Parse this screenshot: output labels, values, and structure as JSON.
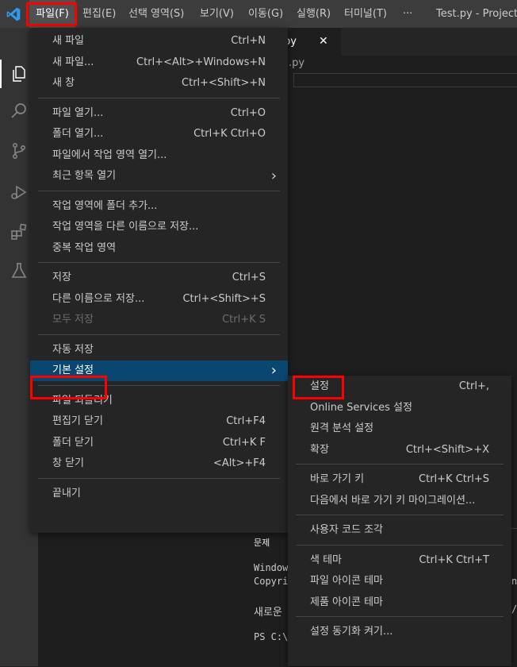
{
  "menubar": {
    "items": [
      "파일(F)",
      "편집(E)",
      "선택 영역(S)",
      "보기(V)",
      "이동(G)",
      "실행(R)",
      "터미널(T)",
      "···"
    ],
    "title": "Test.py - ProjectLic"
  },
  "editor": {
    "tab_label": "py",
    "tab_close": "✕",
    "breadcrumb": ".py"
  },
  "panel": {
    "tab_label": "문제",
    "lines": [
      "Window",
      "Copyri",
      "새로운",
      "PS C:\\"
    ],
    "right_fragments": [
      "nt",
      "/a"
    ]
  },
  "file_menu": {
    "groups": [
      [
        {
          "label": "새 파일",
          "key": "Ctrl+N"
        },
        {
          "label": "새 파일...",
          "key": "Ctrl+<Alt>+Windows+N"
        },
        {
          "label": "새 창",
          "key": "Ctrl+<Shift>+N"
        }
      ],
      [
        {
          "label": "파일 열기...",
          "key": "Ctrl+O"
        },
        {
          "label": "폴더 열기...",
          "key": "Ctrl+K Ctrl+O"
        },
        {
          "label": "파일에서 작업 영역 열기...",
          "key": ""
        },
        {
          "label": "최근 항목 열기",
          "key": "",
          "submenu": true
        }
      ],
      [
        {
          "label": "작업 영역에 폴더 추가...",
          "key": ""
        },
        {
          "label": "작업 영역을 다른 이름으로 저장...",
          "key": ""
        },
        {
          "label": "중복 작업 영역",
          "key": ""
        }
      ],
      [
        {
          "label": "저장",
          "key": "Ctrl+S"
        },
        {
          "label": "다른 이름으로 저장...",
          "key": "Ctrl+<Shift>+S"
        },
        {
          "label": "모두 저장",
          "key": "Ctrl+K S",
          "disabled": true
        }
      ],
      [
        {
          "label": "자동 저장",
          "key": ""
        },
        {
          "label": "기본 설정",
          "key": "",
          "submenu": true,
          "selected": true
        }
      ],
      [
        {
          "label": "파일 되돌리기",
          "key": ""
        },
        {
          "label": "편집기 닫기",
          "key": "Ctrl+F4"
        },
        {
          "label": "폴더 닫기",
          "key": "Ctrl+K F"
        },
        {
          "label": "창 닫기",
          "key": "<Alt>+F4"
        }
      ],
      [
        {
          "label": "끝내기",
          "key": ""
        }
      ]
    ]
  },
  "preferences_menu": {
    "groups": [
      [
        {
          "label": "설정",
          "key": "Ctrl+,"
        },
        {
          "label": "Online Services 설정",
          "key": ""
        },
        {
          "label": "원격 분석 설정",
          "key": ""
        },
        {
          "label": "확장",
          "key": "Ctrl+<Shift>+X"
        }
      ],
      [
        {
          "label": "바로 가기 키",
          "key": "Ctrl+K Ctrl+S"
        },
        {
          "label": "다음에서 바로 가기 키 마이그레이션...",
          "key": ""
        }
      ],
      [
        {
          "label": "사용자 코드 조각",
          "key": ""
        }
      ],
      [
        {
          "label": "색 테마",
          "key": "Ctrl+K Ctrl+T"
        },
        {
          "label": "파일 아이콘 테마",
          "key": ""
        },
        {
          "label": "제품 아이콘 테마",
          "key": ""
        }
      ],
      [
        {
          "label": "설정 동기화 켜기...",
          "key": ""
        }
      ]
    ]
  }
}
